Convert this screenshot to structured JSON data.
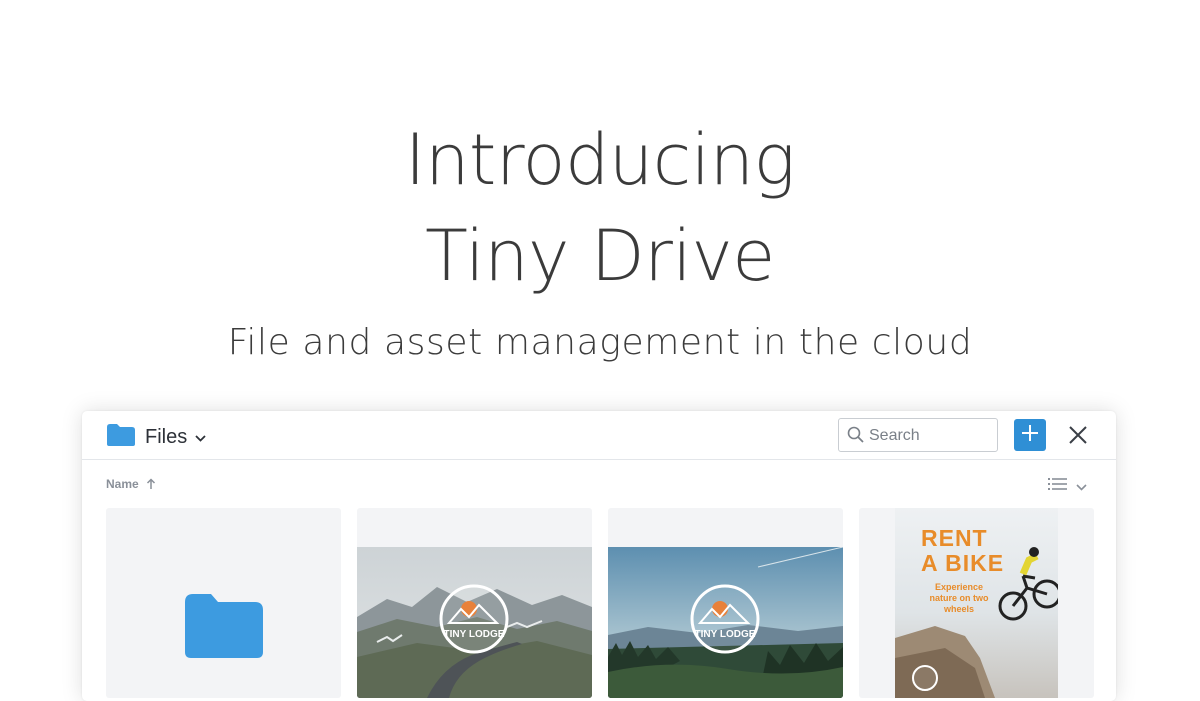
{
  "hero": {
    "title_line1": "Introducing",
    "title_line2": "Tiny Drive",
    "subtitle": "File and asset management in the cloud"
  },
  "toolbar": {
    "folder_icon": "folder-icon",
    "folder_label": "Files",
    "search_placeholder": "Search",
    "add_icon": "plus-icon",
    "close_icon": "close-icon"
  },
  "listing": {
    "sort_label": "Name",
    "sort_direction": "ascending",
    "view_icon": "list-view-icon"
  },
  "files": [
    {
      "type": "folder",
      "icon": "folder-icon"
    },
    {
      "type": "image",
      "logo_text": "TINY LODGE"
    },
    {
      "type": "image",
      "logo_text": "TINY LODGE"
    },
    {
      "type": "poster",
      "headline_line1": "RENT",
      "headline_line2": "A BIKE",
      "tagline": "Experience nature on two wheels"
    }
  ],
  "colors": {
    "accent": "#2f8fd5",
    "folder": "#3d9be0",
    "poster_orange": "#e88c2a"
  }
}
